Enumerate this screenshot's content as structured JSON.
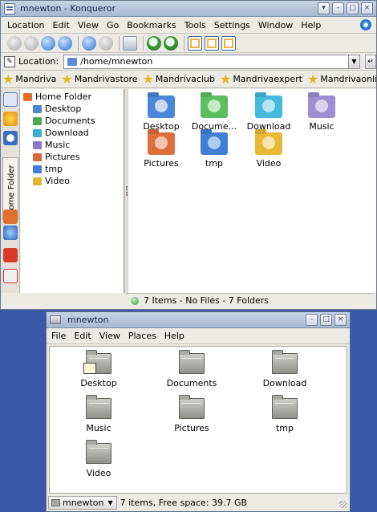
{
  "konqueror": {
    "title": "mnewton - Konqueror",
    "menus": [
      "Location",
      "Edit",
      "View",
      "Go",
      "Bookmarks",
      "Tools",
      "Settings",
      "Window",
      "Help"
    ],
    "location_label": "Location:",
    "location_value": "/home/mnewton",
    "bookmarks": [
      "Mandriva",
      "Mandrivastore",
      "Mandrivaclub",
      "Mandrivaexpert",
      "Mandrivaonline"
    ],
    "bookmarks_more": "»",
    "sidebar_tab_label": "Home Folder",
    "tree": {
      "root": "Home Folder",
      "children": [
        "Desktop",
        "Documents",
        "Download",
        "Music",
        "Pictures",
        "tmp",
        "Video"
      ]
    },
    "icons": [
      "Desktop",
      "Docume...",
      "Download",
      "Music",
      "Pictures",
      "tmp",
      "Video"
    ],
    "status": "7 Items - No Files - 7 Folders",
    "colors": {
      "titlebar": "#b6c5dc",
      "folder_blue": "#4a86d9",
      "accent": "#2d6fcf"
    }
  },
  "nautilus": {
    "title": "mnewton",
    "menus": [
      "File",
      "Edit",
      "View",
      "Places",
      "Help"
    ],
    "items": [
      "Desktop",
      "Documents",
      "Download",
      "Music",
      "Pictures",
      "tmp",
      "Video"
    ],
    "location": "mnewton",
    "status": "7 items, Free space: 39.7 GB"
  },
  "desktop_bg": "#3a58a8"
}
